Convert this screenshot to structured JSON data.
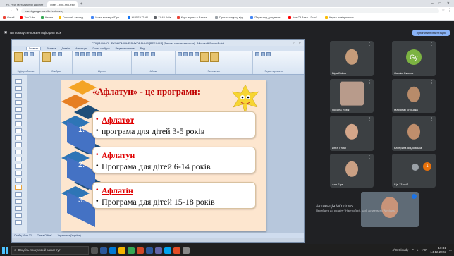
{
  "browser": {
    "tabs": [
      {
        "label": "Уч. Рей: Методичний кабінет",
        "active": false
      },
      {
        "label": "Meet - bnh-hfjo-eby",
        "active": true
      }
    ],
    "url": "meet.google.com/bnh-hfjo-eby",
    "bookmarks": [
      {
        "label": "Gmail",
        "color": "#ea4335"
      },
      {
        "label": "YouTube",
        "color": "#ff0000"
      },
      {
        "label": "Карти",
        "color": "#34a853"
      },
      {
        "label": "Горений заклад...",
        "color": "#fbbc04"
      },
      {
        "label": "Нова вкладка/Про...",
        "color": "#4285f4"
      },
      {
        "label": "HUBSY GAR",
        "color": "#1877f2"
      },
      {
        "label": "11:45 Київ",
        "color": "#5f6368"
      },
      {
        "label": "Курс видео в Бахма...",
        "color": "#ea4335"
      },
      {
        "label": "Прогнал курсу від...",
        "color": "#9aa0a6"
      },
      {
        "label": "Перегляд документ...",
        "color": "#4285f4"
      },
      {
        "label": "Ace Of Base - Don't...",
        "color": "#ff0000"
      },
      {
        "label": "Карта повітряних т...",
        "color": "#fbbc04"
      }
    ]
  },
  "meet": {
    "presenting_text": "Ви показуєте презентацію для всіх",
    "stop_label": "Зупинити презентацію"
  },
  "ppt": {
    "title": "СОЦІАЛЬНО - ЕКОНОМІЧНЕ ВИХОВАННЯ [ВЕБІНАР] [Режим совместимости] - Microsoft PowerPoint",
    "tabs": [
      "Главная",
      "Вставка",
      "Дизайн",
      "Анимация",
      "Показ слайдов",
      "Рецензирование",
      "Вид"
    ],
    "ribbon_groups": [
      "Буфер обмена",
      "Слайды",
      "Шрифт",
      "Абзац",
      "Рисование",
      "Редактирование"
    ],
    "status": [
      "Слайд 16 из 32",
      "\"Тема Office\"",
      "Українська (Україна)"
    ]
  },
  "slide": {
    "heading": "«Афлатун» - це програми:",
    "items": [
      {
        "num": "1.",
        "name": "Афлатот",
        "desc": "програма для дітей 3-5 років"
      },
      {
        "num": "2.",
        "name": "Афлатун",
        "desc": "Програма для дітей 6-14 років"
      },
      {
        "num": "3.",
        "name": "Афлатін",
        "desc": "Програма для дітей 15-18 років"
      }
    ]
  },
  "participants": [
    {
      "name": "Віра Бойко"
    },
    {
      "name": "Оцтаіа Оксана",
      "initials": "Gy"
    },
    {
      "name": "Оксана Ясюк"
    },
    {
      "name": "Мар'яна Потоцька"
    },
    {
      "name": "Инга Гусар"
    },
    {
      "name": "Катерина Відловська"
    },
    {
      "name": "Аня Бри..."
    },
    {
      "name": "Ще 13 осіб",
      "count": "1"
    }
  ],
  "activation": {
    "line1": "Активація Windows",
    "line2": "Перейдіть до розділу \"Настройки\", щоб активувати Windows."
  },
  "taskbar": {
    "search_placeholder": "Введіть пошуковий запит тут",
    "weather": "-4°C Cloudy",
    "lang": "УКР",
    "time": "10:41",
    "date": "14.12.2022"
  },
  "colors": {
    "accent": "#8ab4f8",
    "slide_red": "#e00000",
    "slide_bg": "#fde6cf"
  }
}
